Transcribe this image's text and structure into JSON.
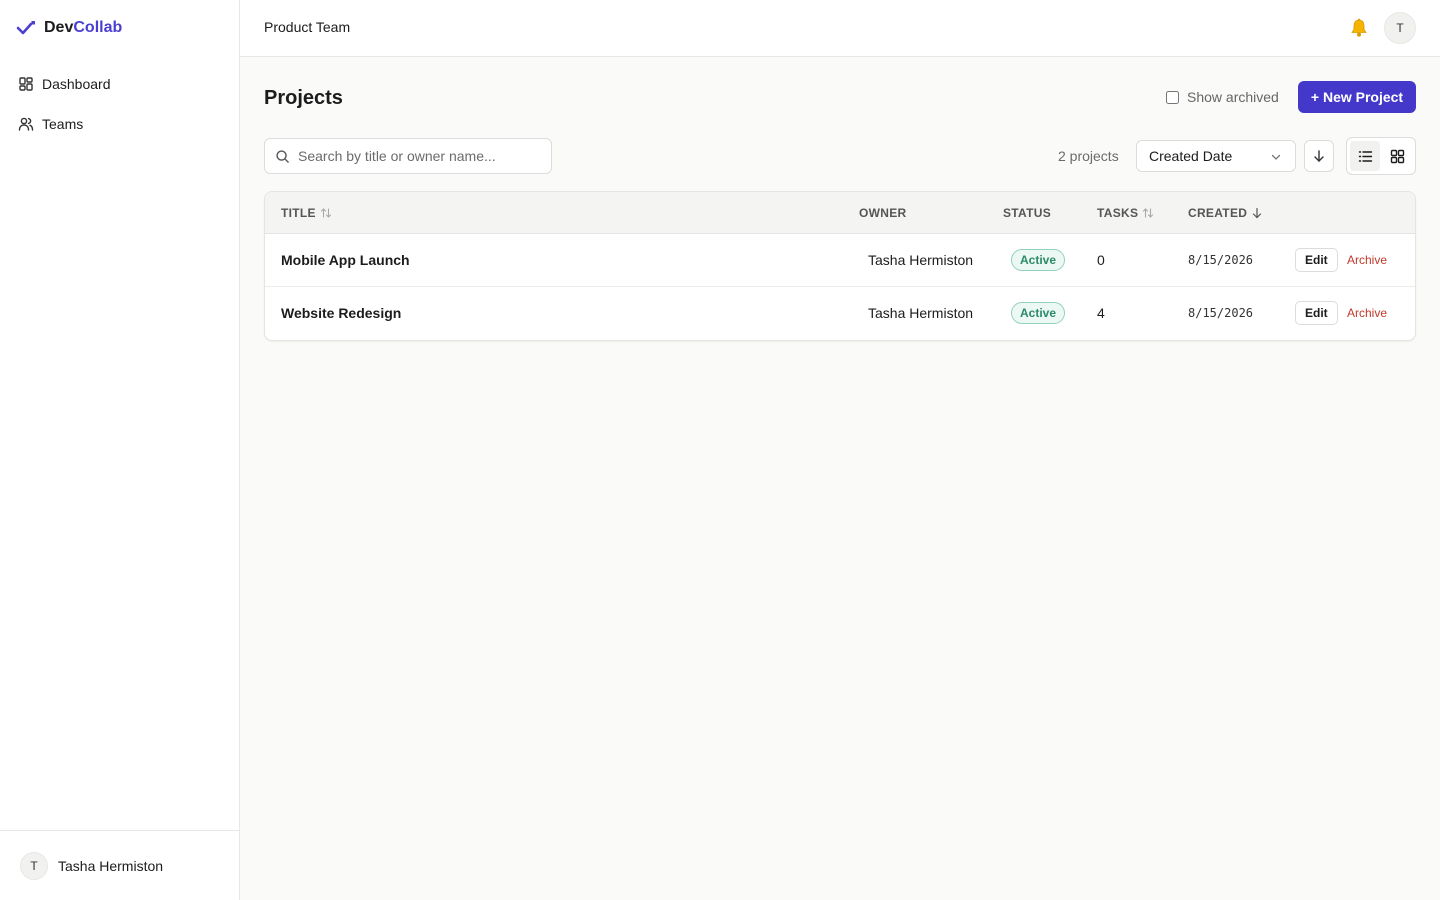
{
  "brand": {
    "name_part1": "Dev",
    "name_part2": "Collab",
    "accent": "#4a3fd1"
  },
  "sidebar": {
    "items": [
      {
        "label": "Dashboard",
        "icon": "grid-icon"
      },
      {
        "label": "Teams",
        "icon": "users-icon"
      }
    ],
    "user": {
      "initial": "T",
      "name": "Tasha Hermiston"
    }
  },
  "topbar": {
    "team_name": "Product Team",
    "user_initial": "T"
  },
  "main": {
    "title": "Projects",
    "show_archived_label": "Show archived",
    "new_project_label": "+ New Project",
    "search_placeholder": "Search by title or owner name...",
    "count_label": "2 projects",
    "sort_selected": "Created Date",
    "table": {
      "headers": {
        "title": "TITLE",
        "owner": "OWNER",
        "status": "STATUS",
        "tasks": "TASKS",
        "created": "CREATED"
      },
      "rows": [
        {
          "title": "Mobile App Launch",
          "owner": "Tasha Hermiston",
          "status": "Active",
          "tasks": "0",
          "created": "8/15/2026",
          "edit": "Edit",
          "archive": "Archive"
        },
        {
          "title": "Website Redesign",
          "owner": "Tasha Hermiston",
          "status": "Active",
          "tasks": "4",
          "created": "8/15/2026",
          "edit": "Edit",
          "archive": "Archive"
        }
      ]
    }
  }
}
